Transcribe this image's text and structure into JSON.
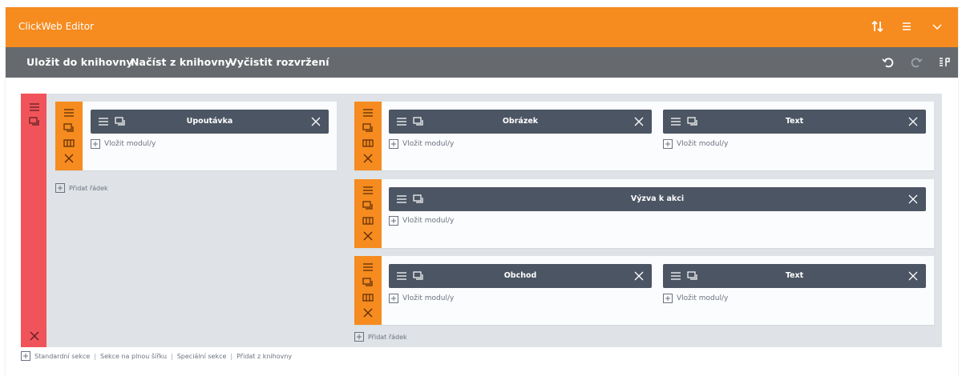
{
  "app": {
    "title": "ClickWeb Editor"
  },
  "title_icons": [
    "sort-icon",
    "menu-icon",
    "chevron-down-icon"
  ],
  "toolbar": {
    "save": "Uložit do knihovny",
    "load": "Načíst z knihovny",
    "clear": "Vyčistit rozvržení",
    "icons": [
      "undo-icon",
      "redo-icon",
      "columns-icon"
    ]
  },
  "colors": {
    "titlebar": "#f68b1f",
    "toolbar": "#666a6e",
    "section": "#f0545a",
    "row": "#f68b1f",
    "module": "#4b5563",
    "canvas": "#dfe3e7"
  },
  "labels": {
    "insert_module": "Vložit modul/y",
    "add_row": "Přidat řádek"
  },
  "left_column": {
    "rows": [
      {
        "modules": [
          "Upoutávka"
        ]
      }
    ]
  },
  "right_column": {
    "rows": [
      {
        "modules": [
          "Obrázek",
          "Text"
        ]
      },
      {
        "modules": [
          "Výzva k akci"
        ]
      },
      {
        "modules": [
          "Obchod",
          "Text"
        ]
      }
    ]
  },
  "footer": {
    "links": [
      "Standardní sekce",
      "Sekce na plnou šířku",
      "Speciální sekce",
      "Přidat z knihovny"
    ]
  }
}
